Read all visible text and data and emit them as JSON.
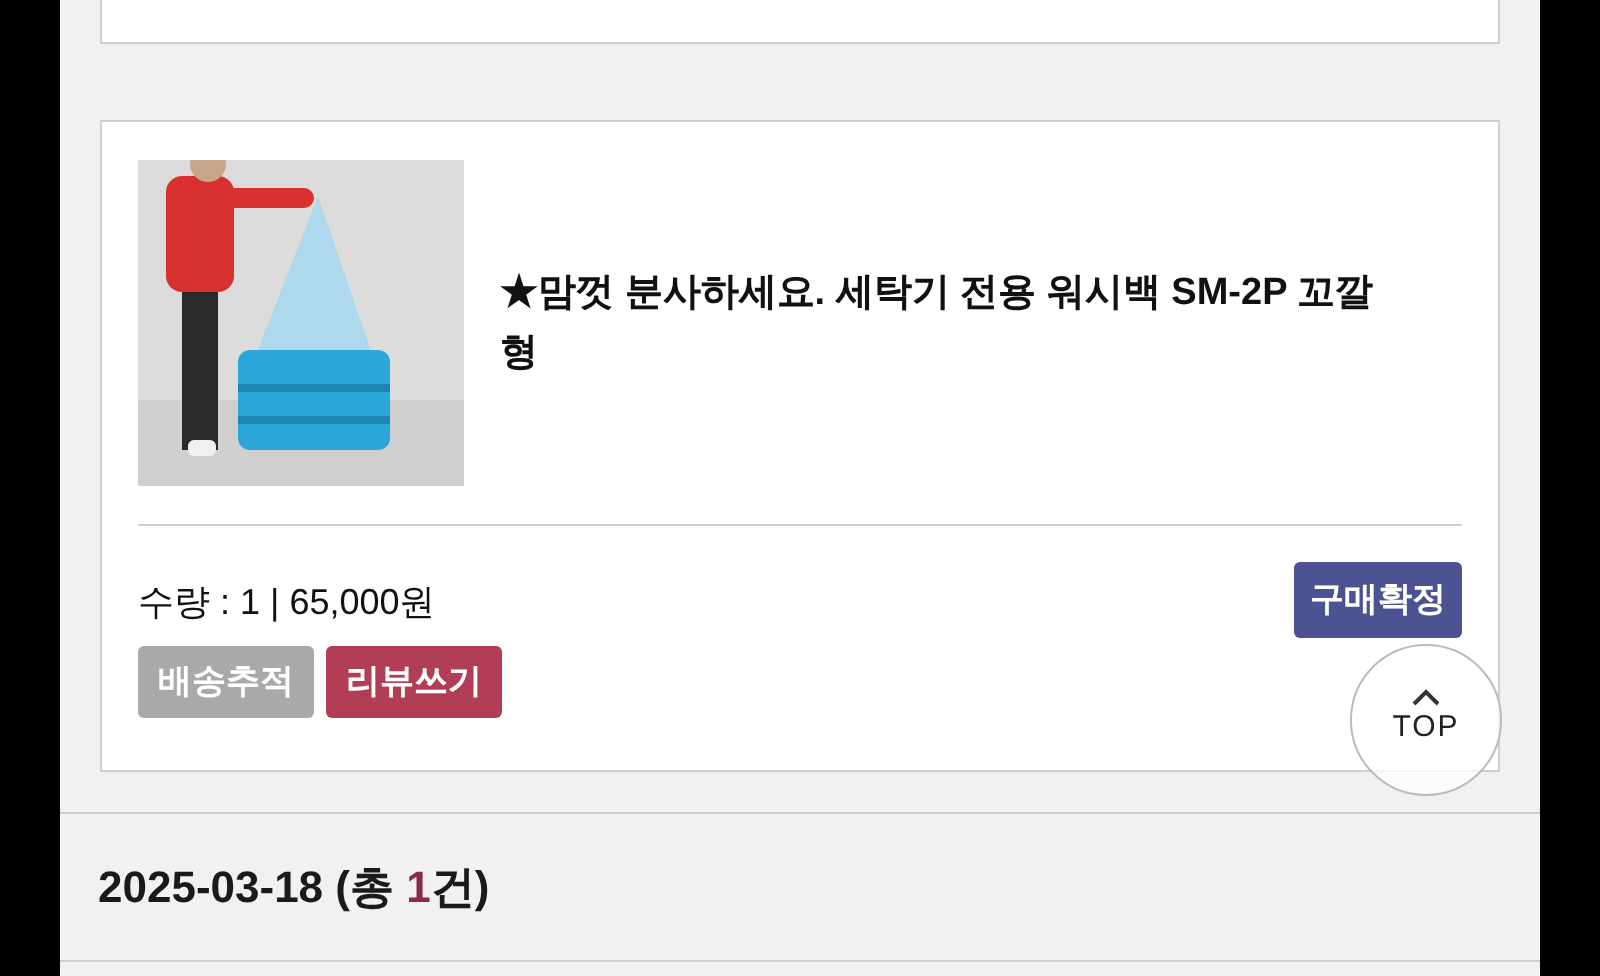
{
  "order": {
    "title": "★맘껏 분사하세요. 세탁기 전용 워시백 SM-2P 꼬깔형",
    "quantity": "수량 : 1 | 65,000원",
    "confirm_button": "구매확정",
    "buttons": [
      {
        "label": "배송추적",
        "color": "#a9a9a9"
      },
      {
        "label": "리뷰쓰기",
        "color": "#b13e55"
      }
    ]
  },
  "top_button": "TOP",
  "date_group": {
    "date": "2025-03-18",
    "count_prefix": "(총",
    "count": "1",
    "count_suffix": "건)"
  }
}
